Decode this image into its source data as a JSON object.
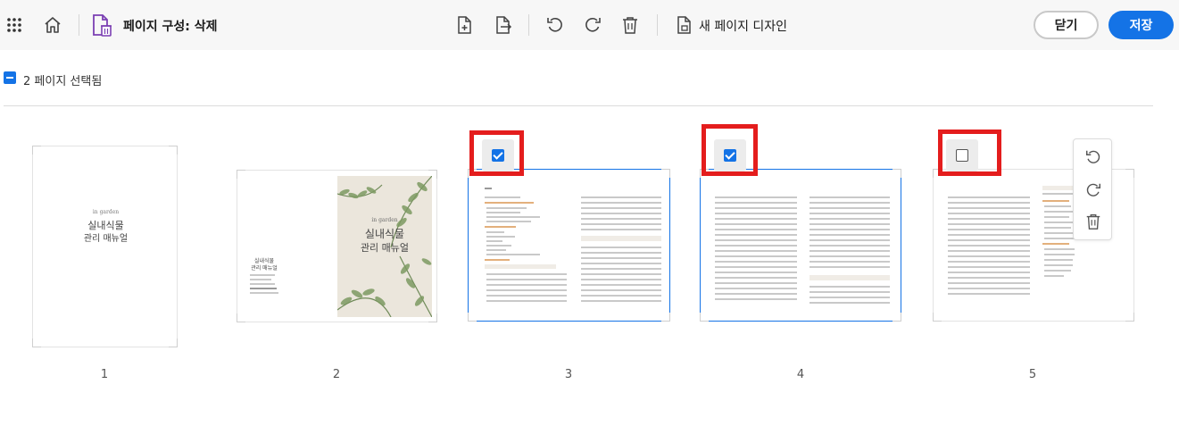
{
  "toolbar": {
    "title": "페이지 구성: 삭제",
    "new_page_design_label": "새 페이지 디자인",
    "close_label": "닫기",
    "save_label": "저장",
    "accent_color": "#1473e6"
  },
  "selection": {
    "summary": "2 페이지 선택됨"
  },
  "pages": [
    {
      "number": "1",
      "selected": false,
      "cover_brand": "in garden",
      "cover_title_1": "실내식물",
      "cover_title_2": "관리 매뉴얼"
    },
    {
      "number": "2",
      "selected": false,
      "cover_brand": "in garden",
      "cover_title_1": "실내식물",
      "cover_title_2": "관리 매뉴얼",
      "back_title_1": "실내식물",
      "back_title_2": "관리 매뉴얼"
    },
    {
      "number": "3",
      "selected": true
    },
    {
      "number": "4",
      "selected": true
    },
    {
      "number": "5",
      "selected": false
    }
  ],
  "page_menu": {
    "icons": [
      "rotate-left-icon",
      "rotate-right-icon",
      "trash-icon"
    ]
  }
}
